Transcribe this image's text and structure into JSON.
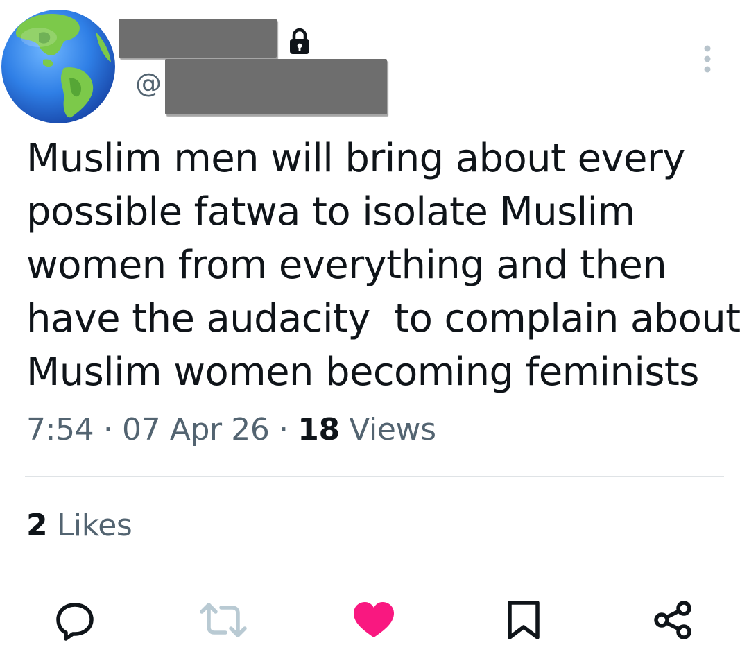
{
  "tweet": {
    "at_sign": "@",
    "text": "Muslim men will bring about every\npossible fatwa to isolate Muslim\nwomen from everything and then\nhave the audacity  to complain about\nMuslim women becoming feminists",
    "time": "7:54",
    "date": "07 Apr 26",
    "separator": "·",
    "views_count": "18",
    "views_label": "Views",
    "likes_count": "2",
    "likes_label": "Likes"
  },
  "icons": {
    "avatar": "globe-emoji",
    "lock": "lock-icon",
    "more": "more-vertical-icon",
    "reply": "reply-icon",
    "retweet": "retweet-icon",
    "like": "heart-filled-icon",
    "bookmark": "bookmark-icon",
    "share": "share-icon"
  },
  "colors": {
    "text_primary": "#0f1419",
    "text_secondary": "#536471",
    "like_active": "#f91880",
    "retweet_disabled": "#b9cad3",
    "redaction": "#6e6e6e"
  }
}
